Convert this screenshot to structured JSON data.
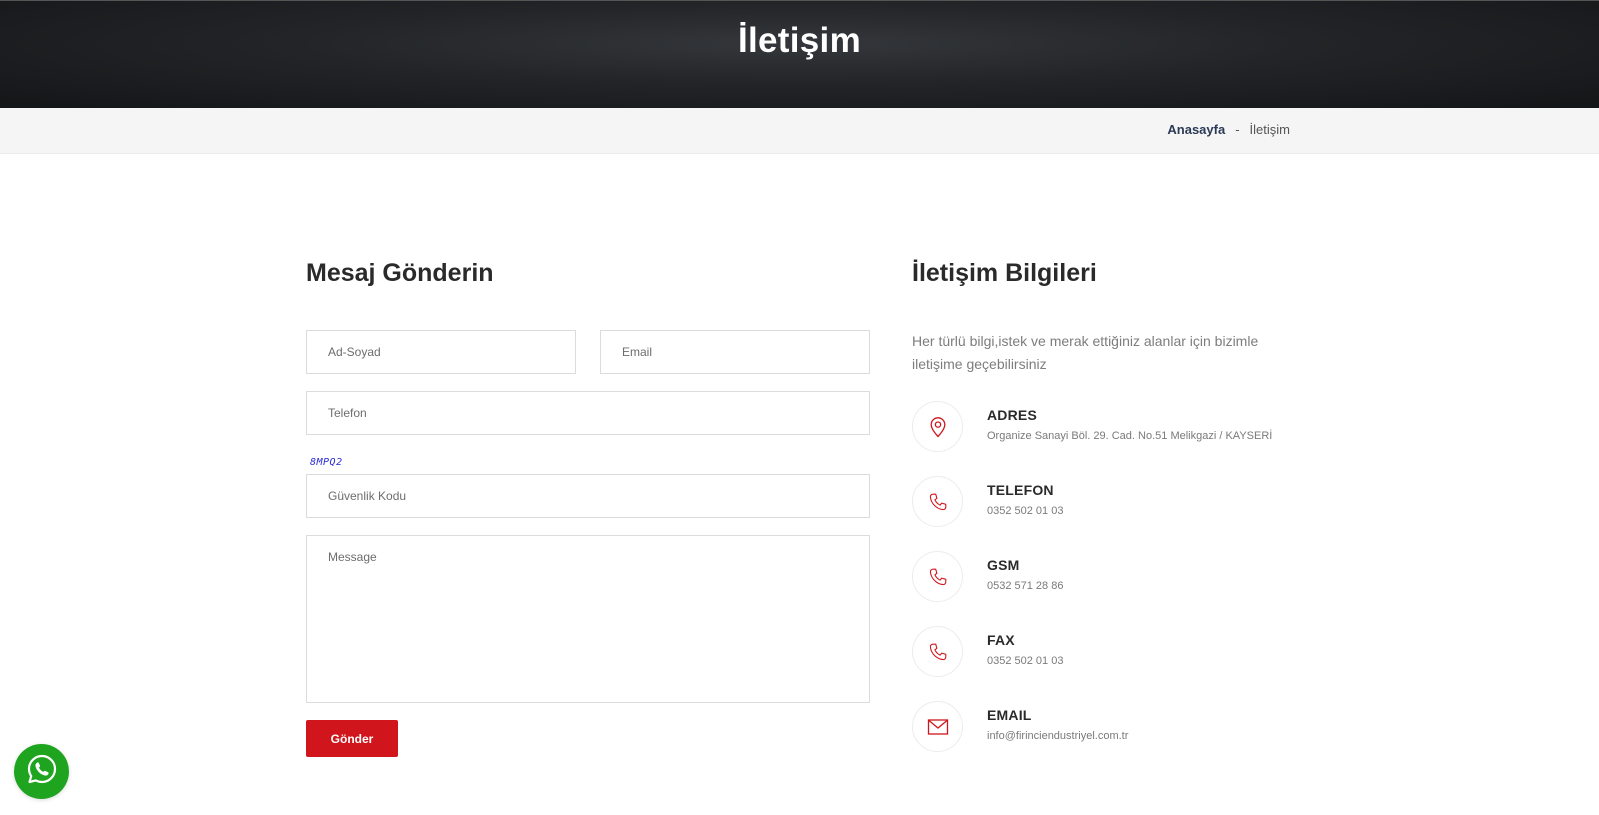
{
  "page": {
    "title": "İletişim"
  },
  "breadcrumb": {
    "home": "Anasayfa",
    "separator": "-",
    "current": "İletişim"
  },
  "form": {
    "title": "Mesaj Gönderin",
    "name_placeholder": "Ad-Soyad",
    "email_placeholder": "Email",
    "phone_placeholder": "Telefon",
    "captcha_text": "8MPQ2",
    "code_placeholder": "Güvenlik Kodu",
    "message_placeholder": "Message",
    "submit_label": "Gönder"
  },
  "contact": {
    "title": "İletişim Bilgileri",
    "intro": "Her türlü bilgi,istek ve merak ettiğiniz alanlar için bizimle iletişime geçebilirsiniz",
    "items": [
      {
        "label": "ADRES",
        "value": "Organize Sanayi Böl. 29. Cad. No.51 Melikgazi / KAYSERİ",
        "icon": "location-pin-icon"
      },
      {
        "label": "TELEFON",
        "value": "0352 502 01 03",
        "icon": "phone-icon"
      },
      {
        "label": "GSM",
        "value": "0532 571 28 86",
        "icon": "phone-icon"
      },
      {
        "label": "FAX",
        "value": "0352 502 01 03",
        "icon": "phone-icon"
      },
      {
        "label": "EMAIL",
        "value": "info@firinciendustriyel.com.tr",
        "icon": "envelope-icon"
      }
    ]
  },
  "colors": {
    "accent": "#d0161c",
    "heading": "#2a2a2a",
    "breadcrumb_link": "#2b3a55",
    "whatsapp": "#1fa41f"
  },
  "floating": {
    "icon": "whatsapp-icon"
  }
}
